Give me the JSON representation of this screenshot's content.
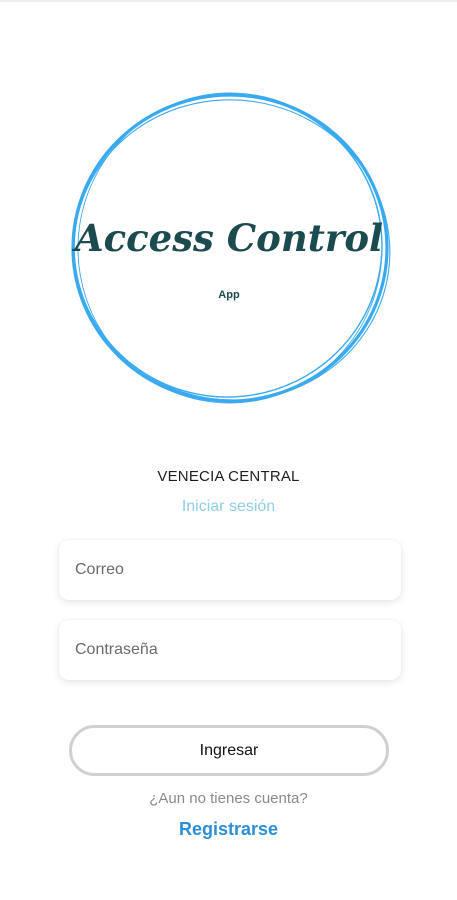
{
  "logo": {
    "title": "Access Control",
    "subtitle": "App",
    "ring_color": "#3aaaf0",
    "text_color": "#1b4a4f"
  },
  "org_name": "VENECIA CENTRAL",
  "login_title": "Iniciar sesión",
  "form": {
    "email_placeholder": "Correo",
    "email_value": "",
    "password_placeholder": "Contraseña",
    "password_value": ""
  },
  "login_button_label": "Ingresar",
  "no_account_text": "¿Aun no tienes cuenta?",
  "register_link_label": "Registrarse",
  "colors": {
    "accent": "#2a8fd6",
    "subtitle_accent": "#8ecfe0",
    "button_border": "#d0d0d0"
  }
}
